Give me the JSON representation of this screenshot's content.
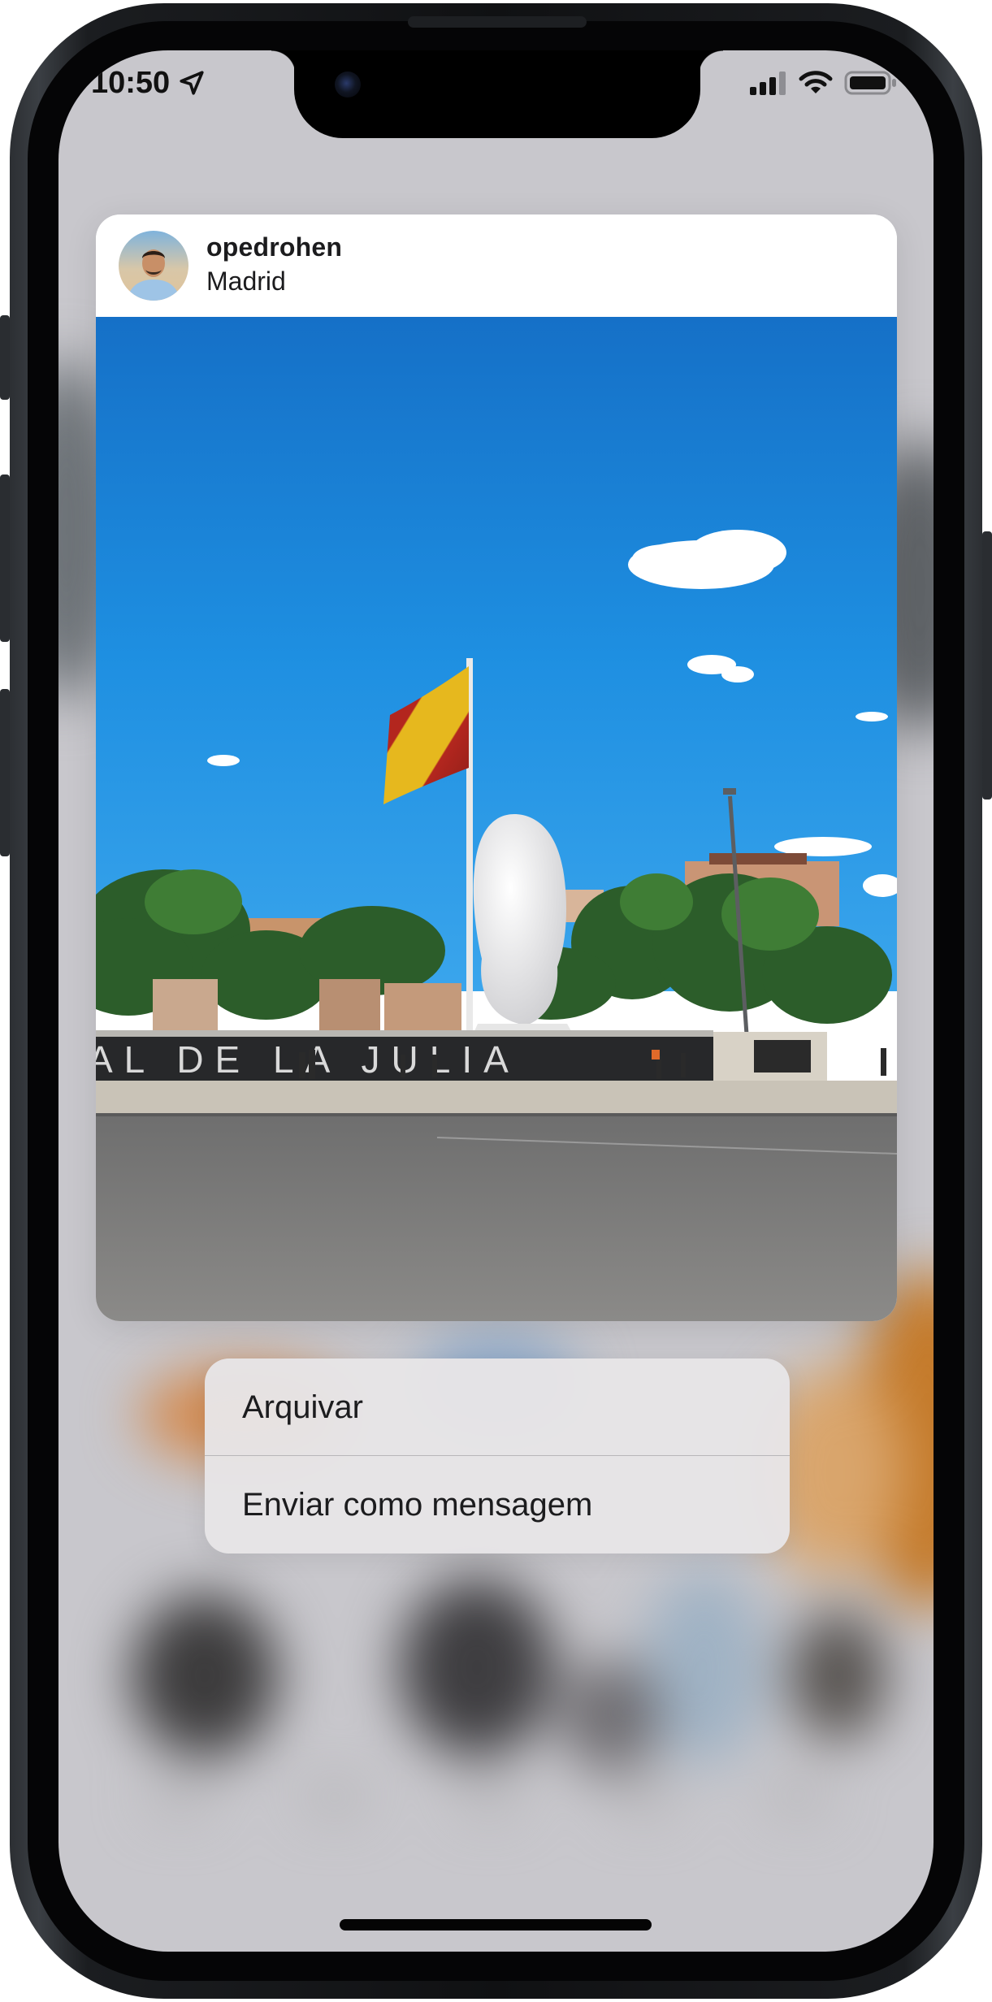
{
  "status_bar": {
    "time": "10:50",
    "location_icon": "location-arrow-icon",
    "signal_icon": "cellular-signal-icon",
    "wifi_icon": "wifi-icon",
    "battery_icon": "battery-icon"
  },
  "post_preview": {
    "username": "opedrohen",
    "location": "Madrid",
    "avatar_icon": "profile-photo"
  },
  "context_menu": {
    "items": [
      {
        "label": "Arquivar"
      },
      {
        "label": "Enviar como mensagem"
      }
    ]
  },
  "colors": {
    "sky": "#1f8fe0",
    "screen_background": "#c8c7cc",
    "menu_background": "#e7e5e7",
    "text": "#1c1c1e"
  }
}
